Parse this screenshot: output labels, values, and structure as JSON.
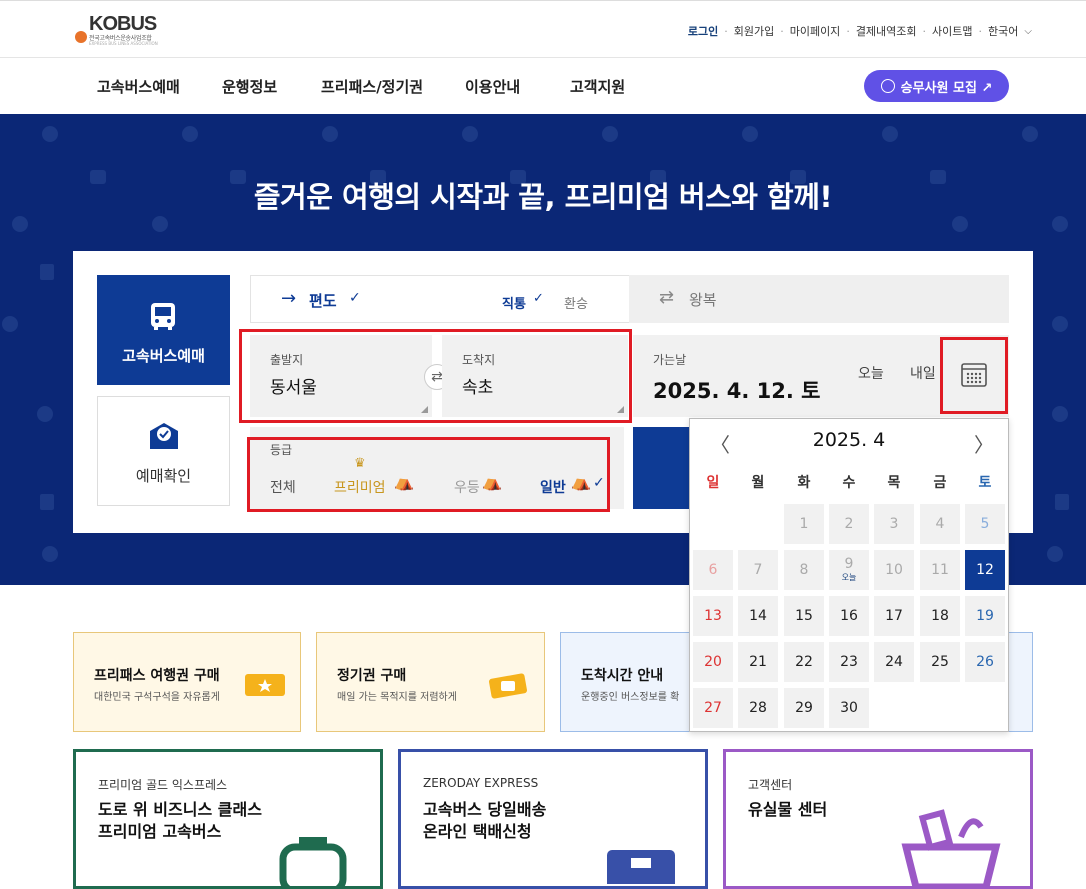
{
  "brand": {
    "logo_text": "KOBUS",
    "logo_sub": "전국고속버스운송사업조합",
    "logo_sub2": "EXPRESS BUS LINES ASSOCIATION"
  },
  "util_nav": [
    "로그인",
    "회원가입",
    "마이페이지",
    "결제내역조회",
    "사이트맵",
    "한국어"
  ],
  "gnb": [
    "고속버스예매",
    "운행정보",
    "프리패스/정기권",
    "이용안내",
    "고객지원"
  ],
  "recruit_label": "승무사원 모집 ↗",
  "hero_title": "즐거운 여행의 시작과 끝, 프리미엄 버스와 함께!",
  "side": {
    "reserve": "고속버스예매",
    "check": "예매확인"
  },
  "trip": {
    "oneway": "편도",
    "direct": "직통",
    "transfer": "환승",
    "round": "왕복"
  },
  "route": {
    "from_label": "출발지",
    "from": "동서울",
    "to_label": "도착지",
    "to": "속초"
  },
  "date": {
    "label": "가는날",
    "value": "2025. 4. 12. 토",
    "today": "오늘",
    "tomorrow": "내일"
  },
  "grade": {
    "label": "등급",
    "options": [
      "전체",
      "프리미엄",
      "우등",
      "일반"
    ],
    "selected": "일반"
  },
  "calendar": {
    "title": "2025. 4",
    "weekdays": [
      "일",
      "월",
      "화",
      "수",
      "목",
      "금",
      "토"
    ],
    "rows": [
      [
        "",
        "1",
        "2",
        "3",
        "4",
        "5"
      ],
      [
        "6",
        "7",
        "8",
        "9",
        "10",
        "11",
        "12"
      ],
      [
        "13",
        "14",
        "15",
        "16",
        "17",
        "18",
        "19"
      ],
      [
        "20",
        "21",
        "22",
        "23",
        "24",
        "25",
        "26"
      ],
      [
        "27",
        "28",
        "29",
        "30"
      ]
    ],
    "today_label": "오늘",
    "selected": "12"
  },
  "cards": [
    {
      "title": "프리패스 여행권 구매",
      "sub": "대한민국 구석구석을 자유롭게"
    },
    {
      "title": "정기권 구매",
      "sub": "매일 가는 목적지를 저렴하게"
    },
    {
      "title": "도착시간 안내",
      "sub": "운행중인 버스정보를 확"
    }
  ],
  "promos": [
    {
      "kicker": "프리미엄 골드 익스프레스",
      "title1": "도로 위 비즈니스 클래스",
      "title2": "프리미엄 고속버스"
    },
    {
      "kicker": "ZERODAY EXPRESS",
      "title1": "고속버스 당일배송",
      "title2": "온라인 택배신청"
    },
    {
      "kicker": "고객센터",
      "title1": "유실물 센터",
      "title2": ""
    }
  ],
  "colors": {
    "navy": "#0b2776",
    "brand_blue": "#0e3b95",
    "purple": "#6051e6",
    "red_highlight": "#e01b24",
    "gold": "#c8961e"
  }
}
